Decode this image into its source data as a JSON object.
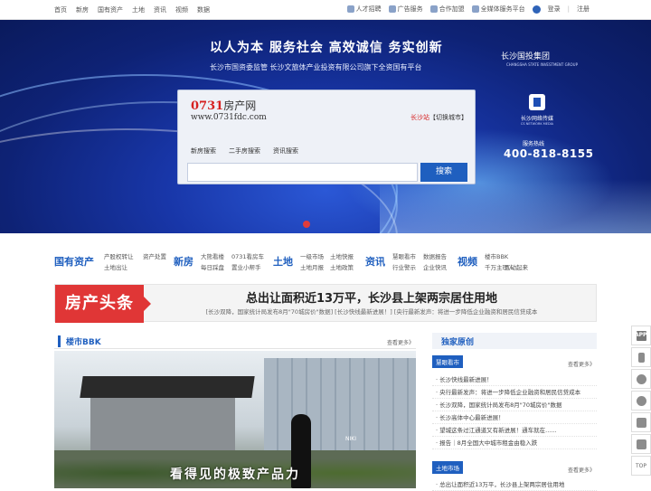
{
  "topbar": {
    "nav": [
      "首页",
      "新房",
      "国有资产",
      "土地",
      "资讯",
      "视频",
      "数据"
    ],
    "links": {
      "recruit": "人才招聘",
      "ads": "广告服务",
      "join": "合作加盟",
      "media": "全媒体服务平台",
      "login": "登录",
      "divider": "|",
      "register": "注册"
    }
  },
  "banner": {
    "slogan": "以人为本  服务社会  高效诚信  务实创新",
    "subslogan": "长沙市国资委监管  长沙文旅体产业投资有限公司旗下全资国有平台",
    "corp_name": "长沙国投集团",
    "corp_sub": "CHANGSHA STATE INVESTMENT GROUP",
    "search": {
      "logo_num": "0731",
      "logo_cn": "房产网",
      "logo_url": "www.0731fdc.com",
      "city": "长沙站",
      "switch_city": "【切换城市】",
      "tabs": [
        "新房搜索",
        "二手房搜索",
        "资讯搜索"
      ],
      "placeholder": "",
      "button": "搜索"
    },
    "media_name": "长沙网络传媒",
    "media_sub": "CS NETWORK MEDIA",
    "hotline_label": "服务热线",
    "hotline": "400-818-8155"
  },
  "categories": [
    {
      "title": "国有资产",
      "links": [
        "产股权转让",
        "资产处置",
        "土地出让"
      ]
    },
    {
      "title": "新房",
      "links": [
        "大熊看楼",
        "0731看房车",
        "每日踩盘",
        "置业小帮手"
      ]
    },
    {
      "title": "土地",
      "links": [
        "一级市场",
        "土地快报",
        "土地月报",
        "土地政策"
      ]
    },
    {
      "title": "资讯",
      "links": [
        "慧眼看市",
        "数据报告",
        "行业警示",
        "企业快讯"
      ]
    },
    {
      "title": "视频",
      "links": [
        "楼市BBK",
        "千万主理人",
        "互动起来"
      ]
    }
  ],
  "headline": {
    "badge": "房产头条",
    "title": "总出让面积近13万平，长沙县上架两宗居住用地",
    "sub": "[长沙双降，国家统计局发布8月\"70城房价\"数据] [长沙快线最新进展！] [央行最新发声：将进一步降低企业融资和居民信贷成本"
  },
  "left_panel": {
    "title": "楼市BBK",
    "more": "查看更多》",
    "photo_caption": "看得见的极致产品力",
    "photo_sign": "NIKI"
  },
  "right_panel": {
    "title": "独家原创",
    "sections": [
      {
        "tag": "慧眼看市",
        "more": "查看更多》",
        "items": [
          "· 长沙快线最新进展！",
          "· 央行最新发声：将进一步降低企业融资和居民信贷成本",
          "· 长沙双降，国家统计局发布8月\"70城房价\"数据",
          "· 长沙高体中心最新进展！",
          "· 望城这条过江通道又有新进展！通车就在......",
          "· 报告｜8月全国大中城市租金由稳入跌"
        ]
      },
      {
        "tag": "土地市场",
        "more": "查看更多》",
        "items": [
          "· 总出让面积近13万平，长沙县上架两宗居住用地"
        ]
      }
    ]
  },
  "float_bar": {
    "app_label": "APP",
    "top_label": "TOP"
  }
}
